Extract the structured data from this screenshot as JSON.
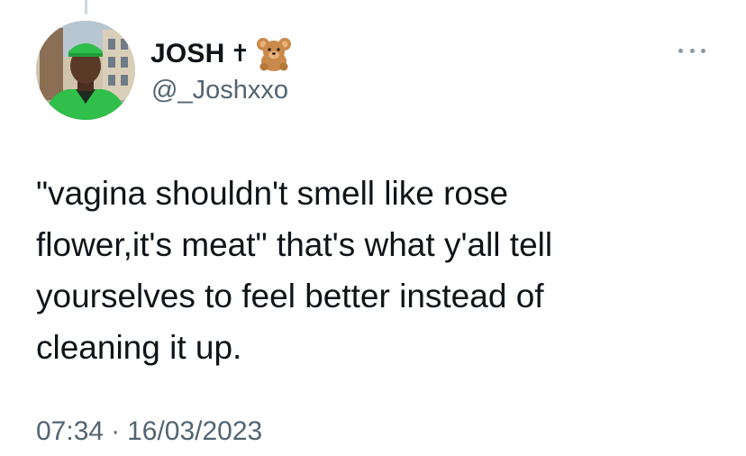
{
  "author": {
    "display_name": "JOSH",
    "name_emoji": [
      "cross-icon",
      "teddy-bear-icon"
    ],
    "handle": "@_Joshxxo"
  },
  "tweet": {
    "text": "\"vagina shouldn't smell like rose\nflower,it's meat\" that's what y'all tell\nyourselves to feel better instead of\ncleaning it up."
  },
  "meta": {
    "time": "07:34",
    "separator": "·",
    "date": "16/03/2023"
  },
  "icons": {
    "more": "more-options-icon"
  },
  "colors": {
    "text": "#0f1419",
    "secondary": "#536471",
    "avatar_jacket": "#2fbf4a"
  }
}
